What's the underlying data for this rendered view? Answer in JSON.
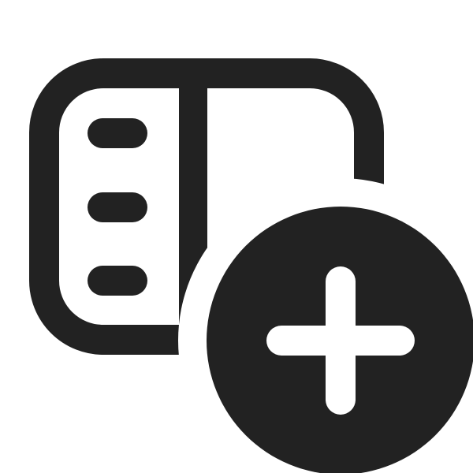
{
  "icon": {
    "name": "sidebar-add-icon",
    "color": "#222222",
    "background": "#ffffff"
  }
}
